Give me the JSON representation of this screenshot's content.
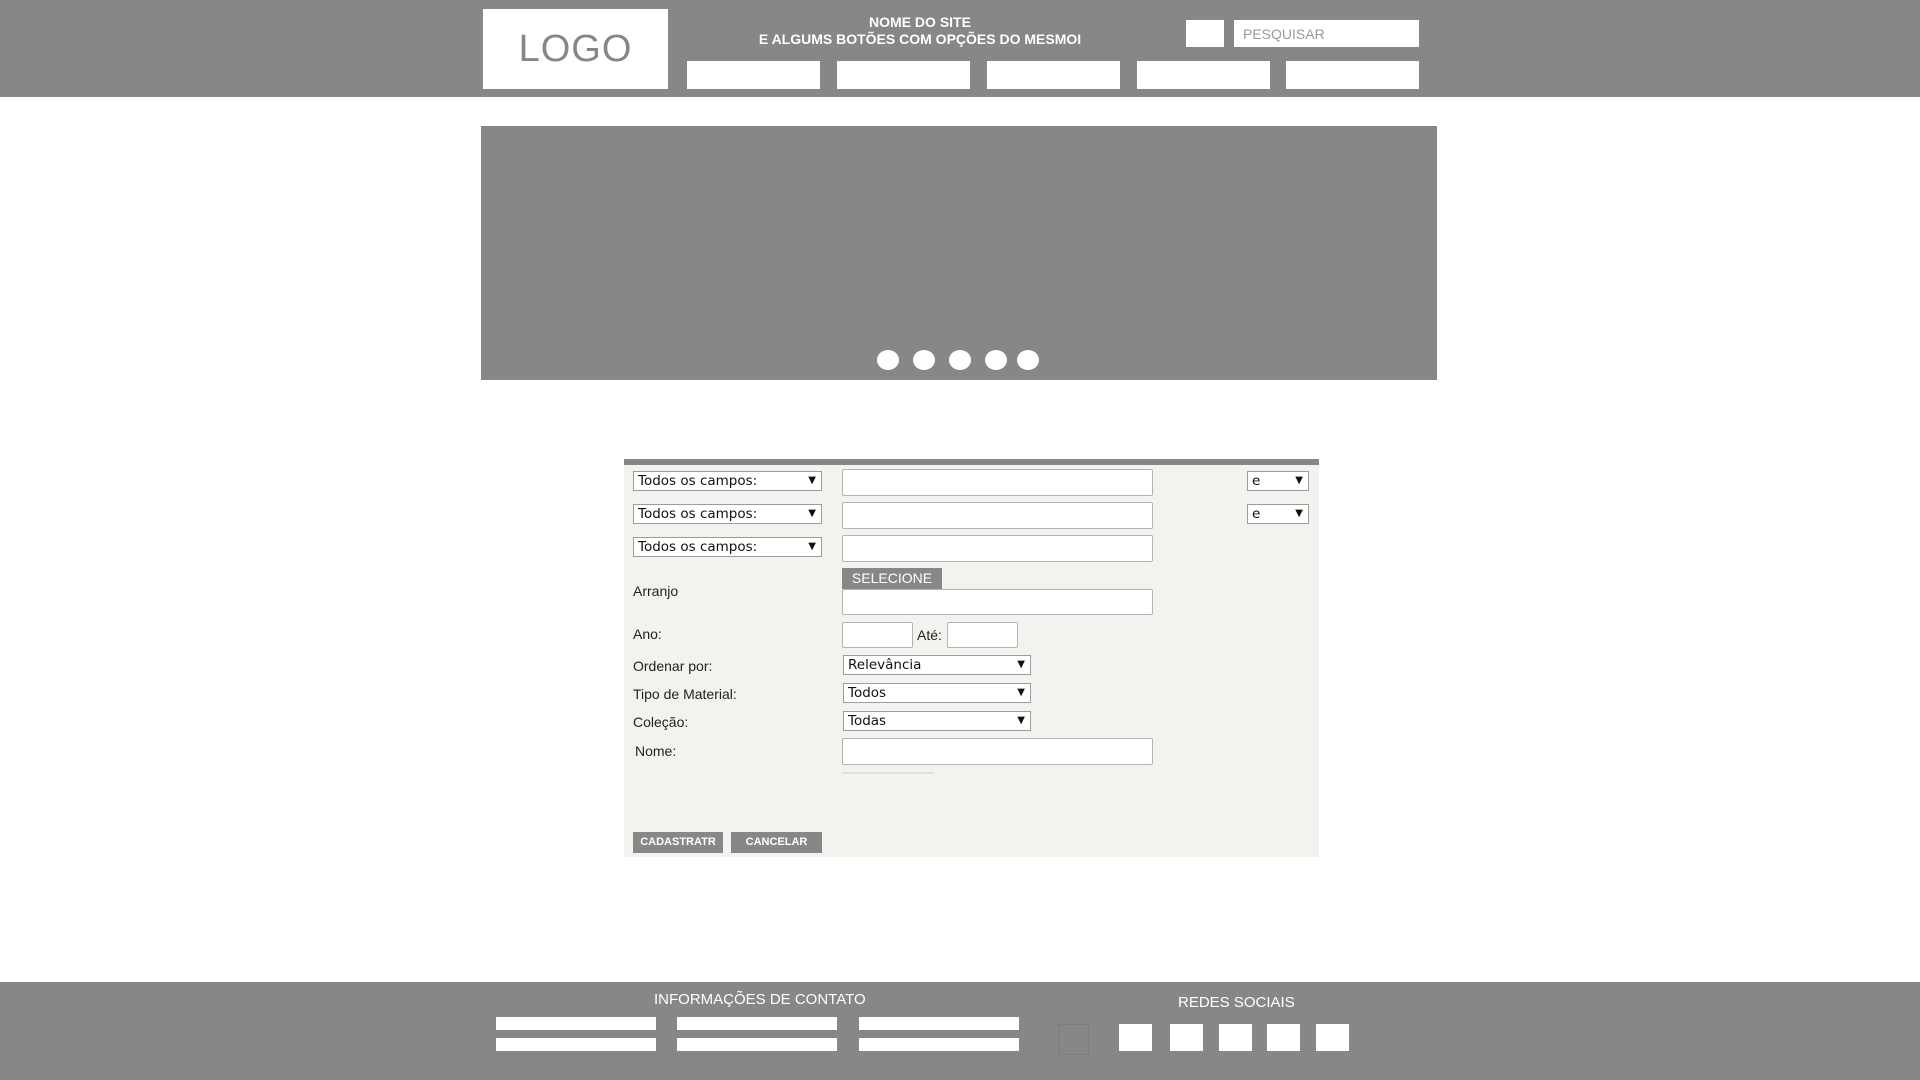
{
  "header": {
    "logo_text": "LOGO",
    "site_name_line1": "NOME DO SITE",
    "site_name_line2": "E ALGUMS BOTÕES COM OPÇÕES DO MESMOI",
    "search_placeholder": "PESQUISAR"
  },
  "form": {
    "field_select_1": "Todos os campos:",
    "field_select_2": "Todos os campos:",
    "field_select_3": "Todos os campos:",
    "operator_1": "e",
    "operator_2": "e",
    "arranjo_label": "Arranjo",
    "selecione_label": "SELECIONE",
    "ano_label": "Ano:",
    "ate_label": "Até:",
    "ordenar_label": "Ordenar por:",
    "ordenar_value": "Relevância",
    "tipo_label": "Tipo de Material:",
    "tipo_value": "Todos",
    "colecao_label": "Coleção:",
    "colecao_value": "Todas",
    "nome_label": "Nome:",
    "cadastrar_label": "CADASTRATR",
    "cancelar_label": "CANCELAR"
  },
  "footer": {
    "contact_title": "INFORMAÇÕES DE CONTATO",
    "social_title": "REDES SOCIAIS"
  },
  "colors": {
    "gray": "#878787",
    "panel_bg": "#f2f2ee",
    "white": "#ffffff"
  }
}
